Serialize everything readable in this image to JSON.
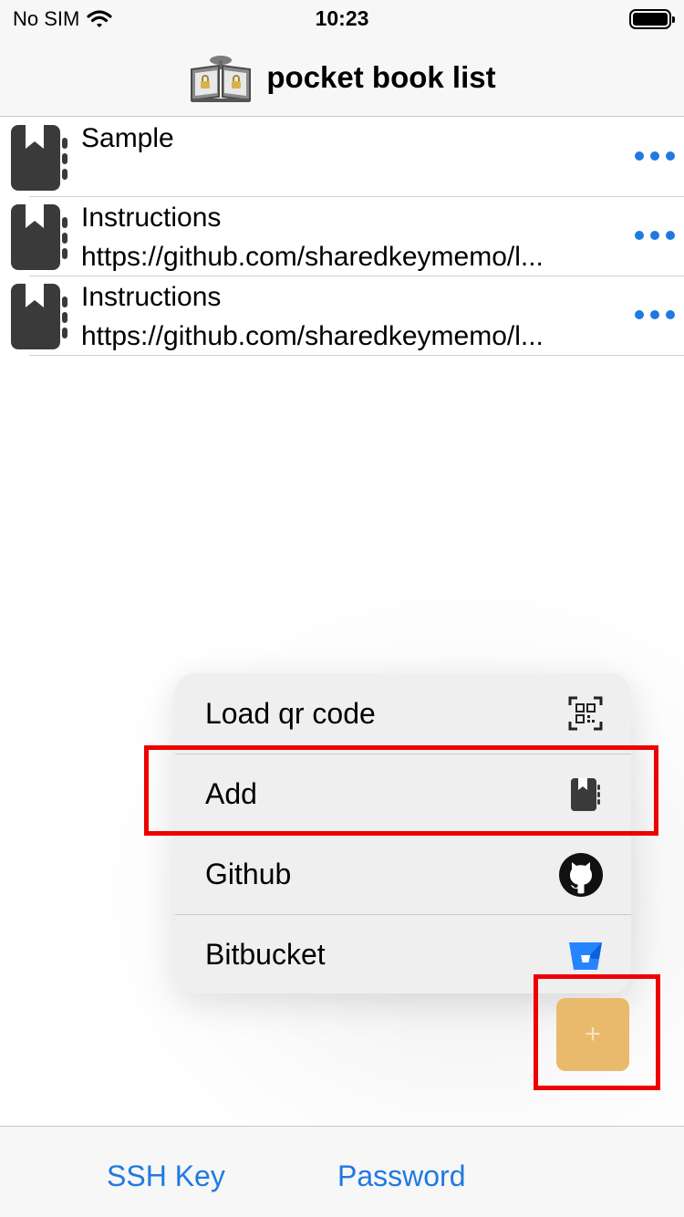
{
  "status_bar": {
    "carrier": "No SIM",
    "time": "10:23"
  },
  "nav": {
    "title": "pocket book list",
    "logo_icon": "open-book-logo-icon"
  },
  "books": [
    {
      "title": "Sample",
      "url": ""
    },
    {
      "title": "Instructions",
      "url": "https://github.com/sharedkeymemo/l..."
    },
    {
      "title": "Instructions",
      "url": "https://github.com/sharedkeymemo/l..."
    }
  ],
  "menu": {
    "items": [
      {
        "label": "Load qr code",
        "icon": "qr-code-icon"
      },
      {
        "label": "Add",
        "icon": "book-icon"
      },
      {
        "label": "Github",
        "icon": "github-icon"
      },
      {
        "label": "Bitbucket",
        "icon": "bitbucket-icon"
      }
    ]
  },
  "fab": {
    "label": "+"
  },
  "tabs": {
    "ssh_key": "SSH Key",
    "password": "Password"
  },
  "colors": {
    "accent": "#1f7ae0",
    "fab": "#e9b96c",
    "highlight": "#ee0000",
    "bitbucket": "#2684ff"
  }
}
